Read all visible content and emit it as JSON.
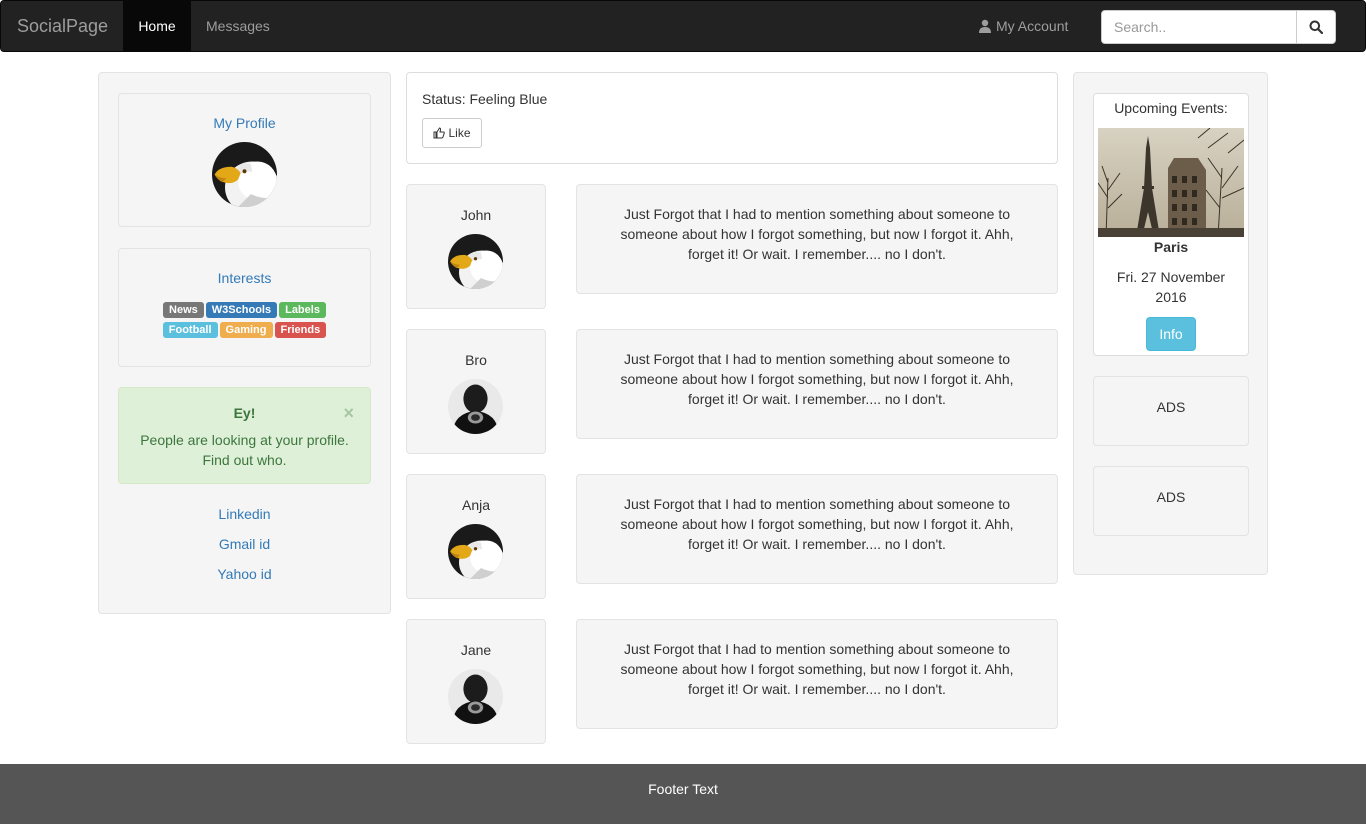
{
  "navbar": {
    "brand": "SocialPage",
    "items": [
      {
        "label": "Home",
        "active": true
      },
      {
        "label": "Messages",
        "active": false
      }
    ],
    "account_label": "My Account",
    "account_icon": "user-icon",
    "search_placeholder": "Search..",
    "search_icon": "search-icon"
  },
  "left": {
    "profile_title": "My Profile",
    "interests_title": "Interests",
    "interests": [
      {
        "label": "News",
        "color": "#777777"
      },
      {
        "label": "W3Schools",
        "color": "#337ab7"
      },
      {
        "label": "Labels",
        "color": "#5cb85c"
      },
      {
        "label": "Football",
        "color": "#5bc0de"
      },
      {
        "label": "Gaming",
        "color": "#f0ad4e"
      },
      {
        "label": "Friends",
        "color": "#d9534f"
      }
    ],
    "alert": {
      "title": "Ey!",
      "text": "People are looking at your profile. Find out who.",
      "close": "×"
    },
    "links": [
      "Linkedin",
      "Gmail id",
      "Yahoo id"
    ]
  },
  "center": {
    "status": "Status: Feeling Blue",
    "like_label": "Like",
    "like_icon": "thumbs-up-icon",
    "posts": [
      {
        "name": "John",
        "avatar": "eagle-avatar",
        "text": "Just Forgot that I had to mention something about someone to someone about how I forgot something, but now I forgot it. Ahh, forget it! Or wait. I remember.... no I don't."
      },
      {
        "name": "Bro",
        "avatar": "dark-avatar",
        "text": "Just Forgot that I had to mention something about someone to someone about how I forgot something, but now I forgot it. Ahh, forget it! Or wait. I remember.... no I don't."
      },
      {
        "name": "Anja",
        "avatar": "eagle-avatar",
        "text": "Just Forgot that I had to mention something about someone to someone about how I forgot something, but now I forgot it. Ahh, forget it! Or wait. I remember.... no I don't."
      },
      {
        "name": "Jane",
        "avatar": "dark-avatar",
        "text": "Just Forgot that I had to mention something about someone to someone about how I forgot something, but now I forgot it. Ahh, forget it! Or wait. I remember.... no I don't."
      }
    ]
  },
  "right": {
    "events_title": "Upcoming Events:",
    "event_city": "Paris",
    "event_date": "Fri. 27 November 2016",
    "info_label": "Info",
    "ads": [
      "ADS",
      "ADS"
    ]
  },
  "footer": {
    "text": "Footer Text"
  },
  "colors": {
    "navbar": "#222222",
    "link": "#337ab7",
    "well": "#f5f5f5",
    "alert_bg": "#dff0d8",
    "info": "#5bc0de",
    "footer": "#555555"
  }
}
